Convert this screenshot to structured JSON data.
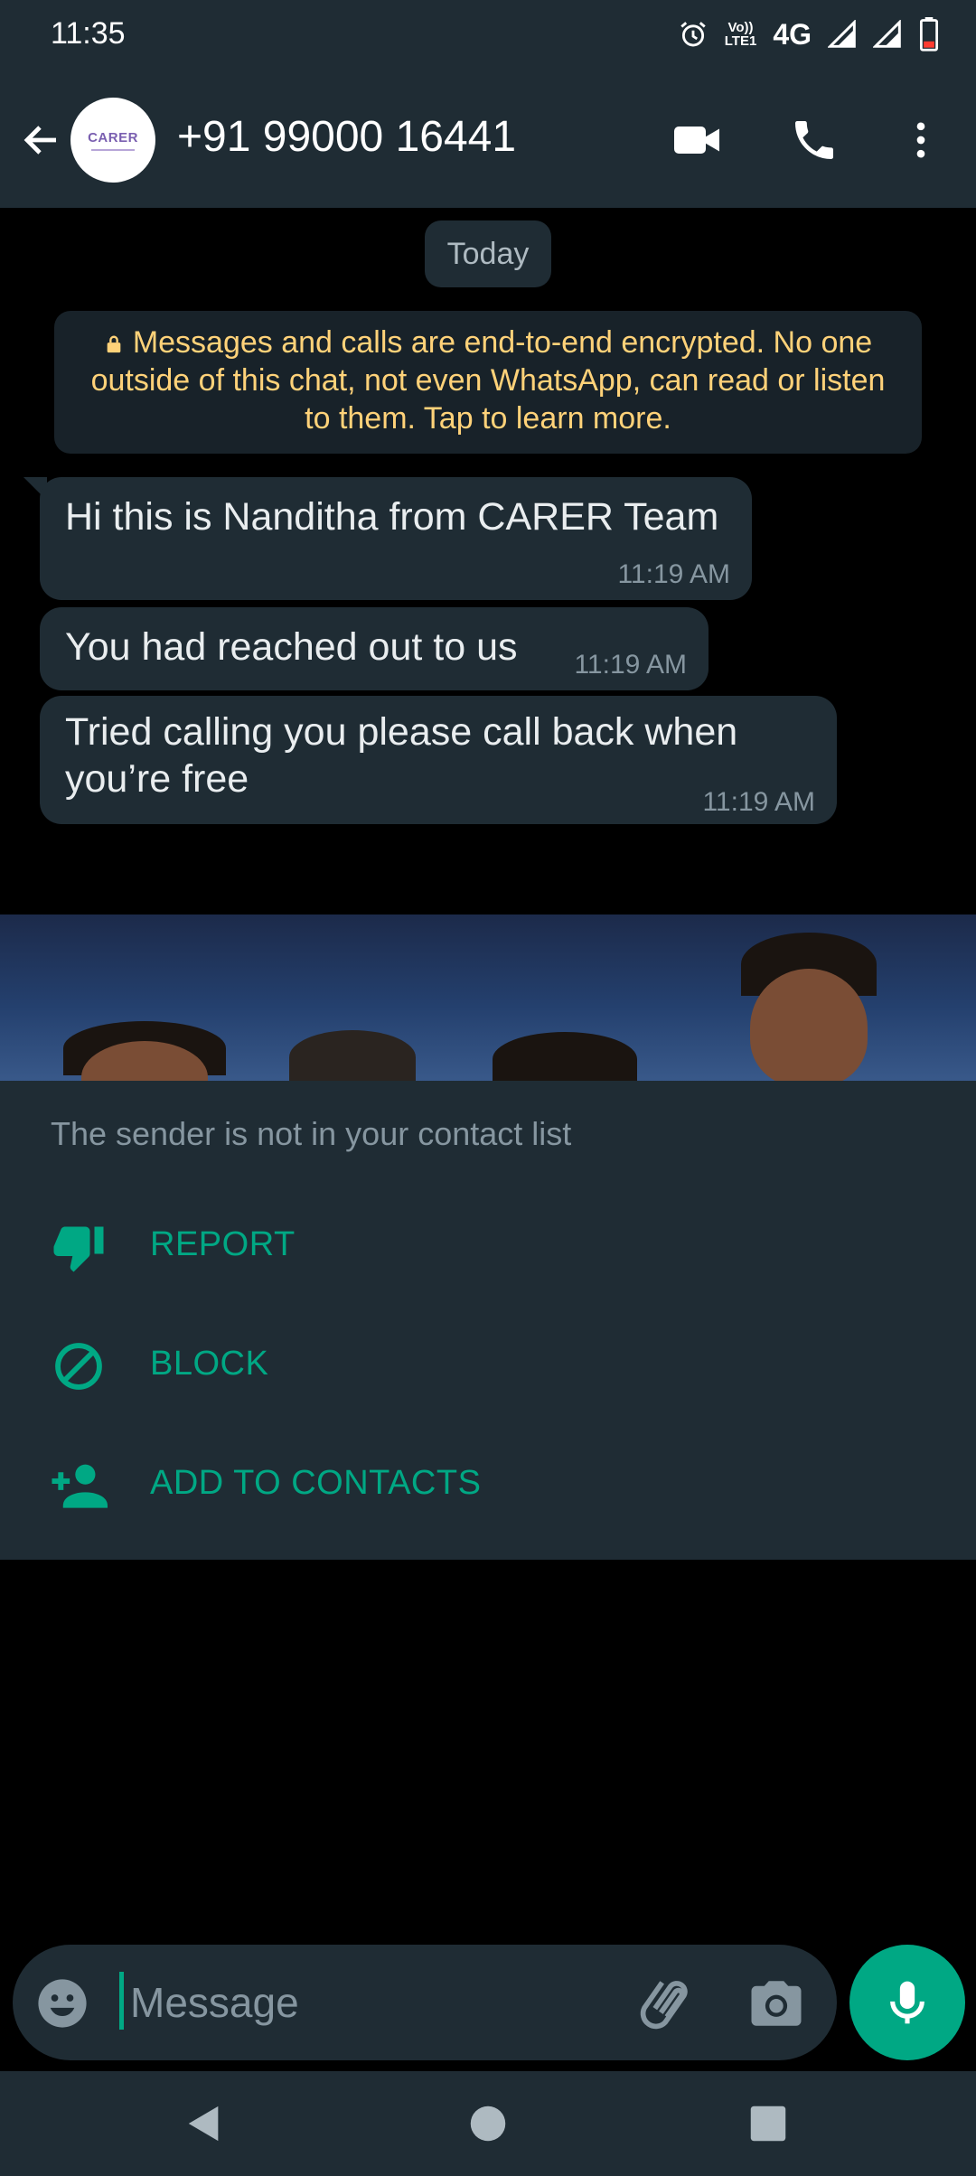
{
  "status_bar": {
    "time": "11:35",
    "volte_top": "Vo))",
    "volte_bottom": "LTE1",
    "network": "4G",
    "icons": [
      "alarm-icon",
      "signal-icon",
      "signal-icon",
      "battery-icon"
    ]
  },
  "header": {
    "contact": "+91 99000 16441",
    "avatar_text": "CARER",
    "icons": [
      "back-arrow-icon",
      "video-call-icon",
      "phone-icon",
      "more-vert-icon"
    ]
  },
  "chat": {
    "date_chip": "Today",
    "encryption_notice": "Messages and calls are end-to-end encrypted. No one outside of this chat, not even WhatsApp, can read or listen to them. Tap to learn more.",
    "messages": [
      {
        "text": "Hi this is Nanditha from CARER Team",
        "time": "11:19 AM"
      },
      {
        "text": "You had reached out to us",
        "time": "11:19 AM"
      },
      {
        "text": "Tried calling you please call back when you’re free",
        "time": "11:19 AM"
      }
    ]
  },
  "unknown_sender_sheet": {
    "note": "The sender is not in your contact list",
    "actions": [
      {
        "label": "REPORT",
        "icon": "thumbs-down-icon"
      },
      {
        "label": "BLOCK",
        "icon": "block-icon"
      },
      {
        "label": "ADD TO CONTACTS",
        "icon": "person-add-icon"
      }
    ]
  },
  "composer": {
    "placeholder": "Message",
    "icons": [
      "emoji-icon",
      "attach-icon",
      "camera-icon",
      "mic-icon"
    ]
  },
  "nav": {
    "icons": [
      "nav-back-icon",
      "nav-home-icon",
      "nav-recents-icon"
    ]
  },
  "colors": {
    "accent": "#00a884",
    "surface": "#1f2c34",
    "notice_text": "#ffd279",
    "background": "#000000"
  }
}
